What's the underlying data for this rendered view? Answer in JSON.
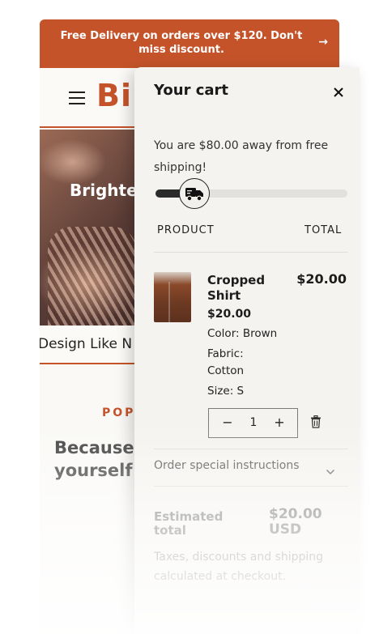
{
  "announcement": {
    "text": "Free Delivery on orders over $120. Don't miss discount.",
    "arrow_icon": "arrow-right-icon"
  },
  "store": {
    "logo": "Bi",
    "hero_text": "Brighte",
    "design_text": "Design Like N",
    "pop_label": "POP",
    "because_line1": "Because",
    "because_line2": "yourself"
  },
  "cart": {
    "title": "Your cart",
    "free_shipping_message": "You are $80.00 away from free shipping!",
    "free_shipping_progress": 0.2,
    "columns": {
      "product": "PRODUCT",
      "total": "TOTAL"
    },
    "item": {
      "name": "Cropped Shirt",
      "unit_price": "$20.00",
      "line_total": "$20.00",
      "color": "Color: Brown",
      "fabric_label": "Fabric:",
      "fabric_value": "Cotton",
      "size": "Size: S",
      "quantity": "1",
      "minus": "−",
      "plus": "+"
    },
    "special_instructions": "Order special instructions",
    "estimated_total_label": "Estimated total",
    "estimated_total_value": "$20.00 USD",
    "taxes_note": "Taxes, discounts and shipping calculated at checkout."
  },
  "colors": {
    "accent": "#c5532a",
    "drawer_bg": "#f5f3ef",
    "text_dark": "#1c1c1c"
  }
}
